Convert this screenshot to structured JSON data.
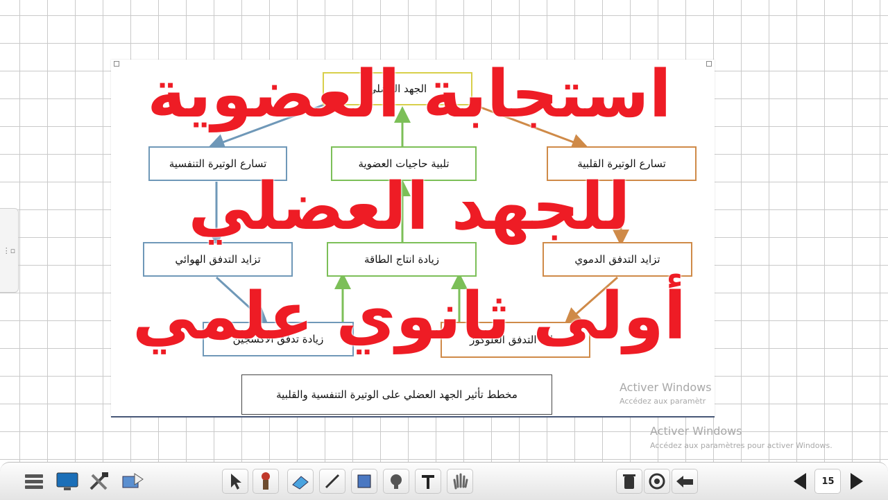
{
  "diagram": {
    "top": "الجهد العضلي",
    "mid_right": "تسارع الوتيرة القلبية",
    "mid_center": "تلبية حاجيات العضوية",
    "mid_left": "تسارع الوتيرة التنفسية",
    "low_right": "تزايد التدفق الدموي",
    "low_center": "زيادة انتاج الطاقة",
    "low_left": "تزايد التدفق الهوائي",
    "bottom_right": "زيادة التدفق الغلوكوز",
    "bottom_left": "زيادة تدفق الأكسجين",
    "caption": "مخطط تأثير الجهد العضلي على الوتيرة التنفسية والقلبية"
  },
  "overlay": {
    "line1": "استجابة العضوية",
    "line2": "للجهد العضلي",
    "line3": "أولى ثانوي علمي"
  },
  "watermark": {
    "slide_title": "Activer Windows",
    "slide_sub": "Accédez aux paramètr",
    "screen_title": "Activer Windows",
    "screen_sub": "Accédez aux paramètres pour activer Windows."
  },
  "toolbar": {
    "page_number": "15",
    "icons": [
      "menu-icon",
      "display-icon",
      "tools-icon",
      "screen-capture-icon",
      "select-arrow-icon",
      "pen-icon",
      "eraser-icon",
      "line-icon",
      "rectangle-icon",
      "fill-icon",
      "text-icon",
      "hand-icon",
      "delete-icon",
      "target-icon",
      "undo-icon",
      "prev-page-icon",
      "page-icon",
      "next-page-icon"
    ]
  },
  "colors": {
    "title_red": "#ee1c25",
    "arrow_blue": "#6f98b8",
    "arrow_green": "#7cbf58",
    "arrow_orange": "#cf8a48",
    "box_yellow": "#d8cf4a"
  }
}
